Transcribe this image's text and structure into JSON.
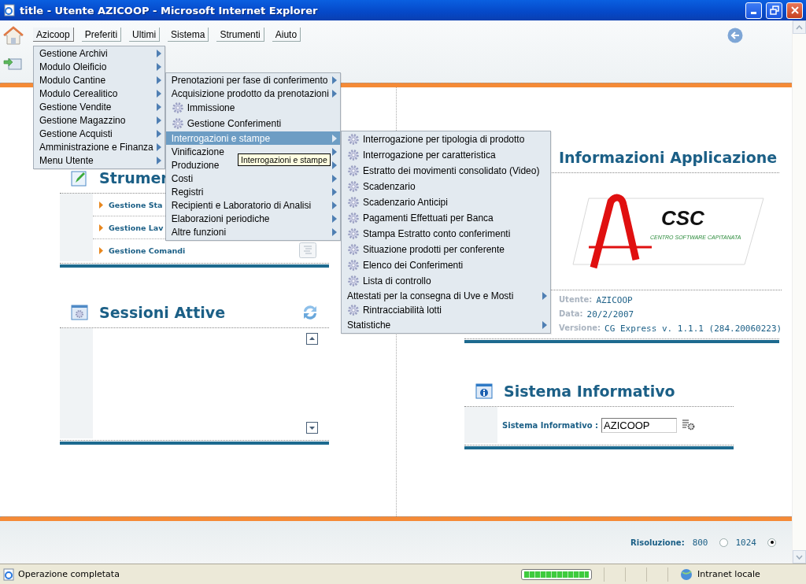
{
  "window": {
    "title": "title - Utente AZICOOP - Microsoft Internet Explorer"
  },
  "menubar": [
    {
      "label": "Azicoop",
      "selected": true
    },
    {
      "label": "Preferiti",
      "selected": false
    },
    {
      "label": "Ultimi",
      "selected": false
    },
    {
      "label": "Sistema",
      "selected": false
    },
    {
      "label": "Strumenti",
      "selected": false
    },
    {
      "label": "Aiuto",
      "selected": false
    }
  ],
  "menu": {
    "items": [
      {
        "label": "Gestione Archivi",
        "kind": "submenu"
      },
      {
        "label": "Modulo Oleificio",
        "kind": "submenu"
      },
      {
        "label": "Modulo Cantine",
        "kind": "submenu",
        "children": [
          {
            "label": "Prenotazioni per fase di conferimento",
            "kind": "submenu",
            "selected": false
          },
          {
            "label": "Acquisizione prodotto da prenotazioni",
            "kind": "submenu",
            "selected": false
          },
          {
            "label": "Immissione",
            "kind": "action",
            "selected": false
          },
          {
            "label": "Gestione Conferimenti",
            "kind": "action",
            "selected": false
          },
          {
            "label": "Interrogazioni e stampe",
            "kind": "submenu",
            "selected": true,
            "children": [
              {
                "label": "Interrogazione per tipologia di prodotto",
                "kind": "action"
              },
              {
                "label": "Interrogazione per caratteristica",
                "kind": "action"
              },
              {
                "label": "Estratto dei movimenti consolidato (Video)",
                "kind": "action"
              },
              {
                "label": "Scadenzario",
                "kind": "action"
              },
              {
                "label": "Scadenzario Anticipi",
                "kind": "action"
              },
              {
                "label": "Pagamenti Effettuati per Banca",
                "kind": "action"
              },
              {
                "label": "Stampa Estratto conto conferimenti",
                "kind": "action"
              },
              {
                "label": "Situazione prodotti per conferente",
                "kind": "action"
              },
              {
                "label": "Elenco dei Conferimenti",
                "kind": "action"
              },
              {
                "label": "Lista di controllo",
                "kind": "action"
              },
              {
                "label": "Attestati per la consegna di Uve e Mosti",
                "kind": "submenu"
              },
              {
                "label": "Rintracciabilità lotti",
                "kind": "action"
              },
              {
                "label": "Statistiche",
                "kind": "submenu"
              }
            ]
          },
          {
            "label": "Vinificazione",
            "kind": "submenu",
            "selected": false
          },
          {
            "label": "Produzione",
            "kind": "submenu",
            "selected": false
          },
          {
            "label": "Costi",
            "kind": "submenu",
            "selected": false
          },
          {
            "label": "Registri",
            "kind": "submenu",
            "selected": false
          },
          {
            "label": "Recipienti e Laboratorio di Analisi",
            "kind": "submenu",
            "selected": false
          },
          {
            "label": "Elaborazioni periodiche",
            "kind": "submenu",
            "selected": false
          },
          {
            "label": "Altre funzioni",
            "kind": "submenu",
            "selected": false
          }
        ]
      },
      {
        "label": "Modulo Cerealitico",
        "kind": "submenu"
      },
      {
        "label": "Gestione Vendite",
        "kind": "submenu"
      },
      {
        "label": "Gestione Magazzino",
        "kind": "submenu"
      },
      {
        "label": "Gestione Acquisti",
        "kind": "submenu"
      },
      {
        "label": "Amministrazione e Finanza",
        "kind": "submenu"
      },
      {
        "label": "Menu Utente",
        "kind": "submenu"
      }
    ]
  },
  "tooltip": "Interrogazioni e stampe",
  "strumenti": {
    "title": "Strumen",
    "links": [
      "Gestione Sta",
      "Gestione Lav",
      "Gestione Comandi"
    ]
  },
  "sessioni": {
    "title": "Sessioni Attive"
  },
  "info": {
    "title": "Informazioni Applicazione",
    "logo": {
      "name": "CSC",
      "tagline": "CENTRO SOFTWARE CAPITANATA"
    },
    "rows": [
      {
        "label": "Utente:",
        "value": "AZICOOP"
      },
      {
        "label": "Data:",
        "value": "20/2/2007"
      },
      {
        "label": "Versione:",
        "value": "CG Express v. 1.1.1 (284.20060223)"
      }
    ]
  },
  "sistema": {
    "title": "Sistema Informativo",
    "field_label": "Sistema Informativo :",
    "value": "AZICOOP"
  },
  "footer": {
    "label": "Risoluzione:",
    "options": [
      {
        "label": "800",
        "selected": false
      },
      {
        "label": "1024",
        "selected": true
      }
    ]
  },
  "status_bar": {
    "text": "Operazione completata",
    "progress": {
      "level": 1
    },
    "zone": "Intranet locale"
  }
}
